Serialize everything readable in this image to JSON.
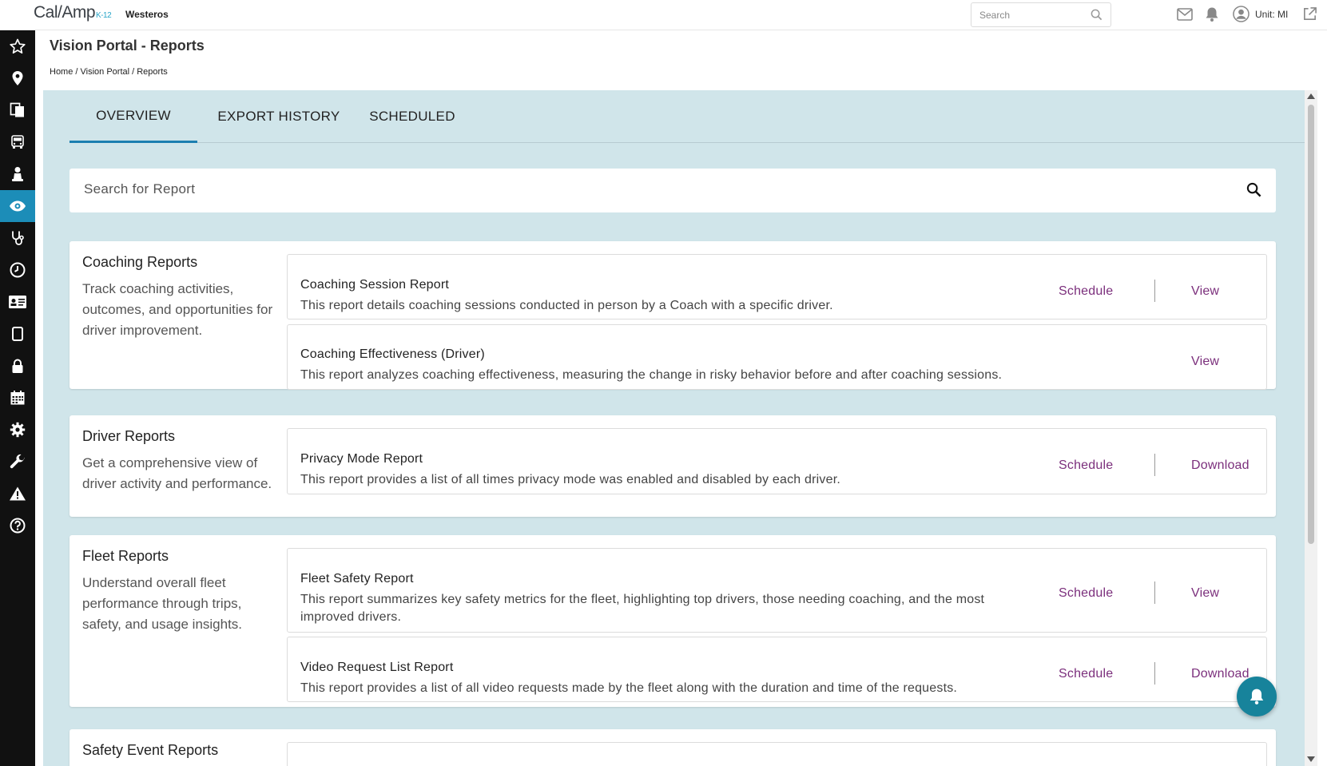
{
  "app": {
    "logo_text": "Cal/Amp",
    "logo_suffix": "K-12",
    "org_name": "Westeros",
    "search_placeholder": "Search",
    "unit_label": "Unit: MI"
  },
  "sidebar": {
    "items": [
      {
        "name": "favorites",
        "icon": "star-icon"
      },
      {
        "name": "location",
        "icon": "map-pin-icon"
      },
      {
        "name": "documents",
        "icon": "documents-icon"
      },
      {
        "name": "vehicle",
        "icon": "vehicle-icon"
      },
      {
        "name": "driver",
        "icon": "driver-icon"
      },
      {
        "name": "vision",
        "icon": "eye-icon",
        "active": true
      },
      {
        "name": "health",
        "icon": "stethoscope-icon"
      },
      {
        "name": "history",
        "icon": "clock-icon"
      },
      {
        "name": "id-card",
        "icon": "id-card-icon"
      },
      {
        "name": "tablet",
        "icon": "tablet-icon"
      },
      {
        "name": "security",
        "icon": "lock-icon"
      },
      {
        "name": "calendar",
        "icon": "calendar-icon"
      },
      {
        "name": "settings",
        "icon": "gear-icon"
      },
      {
        "name": "tools",
        "icon": "wrench-icon"
      },
      {
        "name": "alerts",
        "icon": "warning-icon"
      },
      {
        "name": "help",
        "icon": "help-icon"
      }
    ]
  },
  "page": {
    "title": "Vision Portal - Reports",
    "breadcrumb": "Home / Vision Portal / Reports"
  },
  "tabs": [
    "OVERVIEW",
    "EXPORT HISTORY",
    "SCHEDULED"
  ],
  "report_search": {
    "placeholder": "Search for Report"
  },
  "sections": [
    {
      "title": "Coaching Reports",
      "description": "Track coaching activities, outcomes, and opportunities for driver improvement.",
      "reports": [
        {
          "title": "Coaching Session Report",
          "description": "This report details coaching sessions conducted in person by a Coach with a specific driver.",
          "schedule": "Schedule",
          "action": "View"
        },
        {
          "title": "Coaching Effectiveness (Driver)",
          "description": "This report analyzes coaching effectiveness, measuring the change in risky behavior before and after coaching sessions.",
          "action": "View"
        }
      ]
    },
    {
      "title": "Driver Reports",
      "description": "Get a comprehensive view of driver activity and performance.",
      "reports": [
        {
          "title": "Privacy Mode Report",
          "description": "This report provides a list of all times privacy mode was enabled and disabled by each driver.",
          "schedule": "Schedule",
          "action": "Download"
        }
      ]
    },
    {
      "title": "Fleet Reports",
      "description": "Understand overall fleet performance through trips, safety, and usage insights.",
      "reports": [
        {
          "title": "Fleet Safety Report",
          "description": "This report summarizes key safety metrics for the fleet, highlighting top drivers, those needing coaching, and the most improved drivers.",
          "schedule": "Schedule",
          "action": "View"
        },
        {
          "title": "Video Request List Report",
          "description": "This report provides a list of all video requests made by the fleet along with the duration and time of the requests.",
          "schedule": "Schedule",
          "action": "Download"
        }
      ]
    },
    {
      "title": "Safety Event Reports"
    }
  ],
  "colors": {
    "accent": "#1c8db8",
    "action_link": "#7b2f7c",
    "content_bg": "#d0e5ea",
    "fab": "#17839b"
  }
}
